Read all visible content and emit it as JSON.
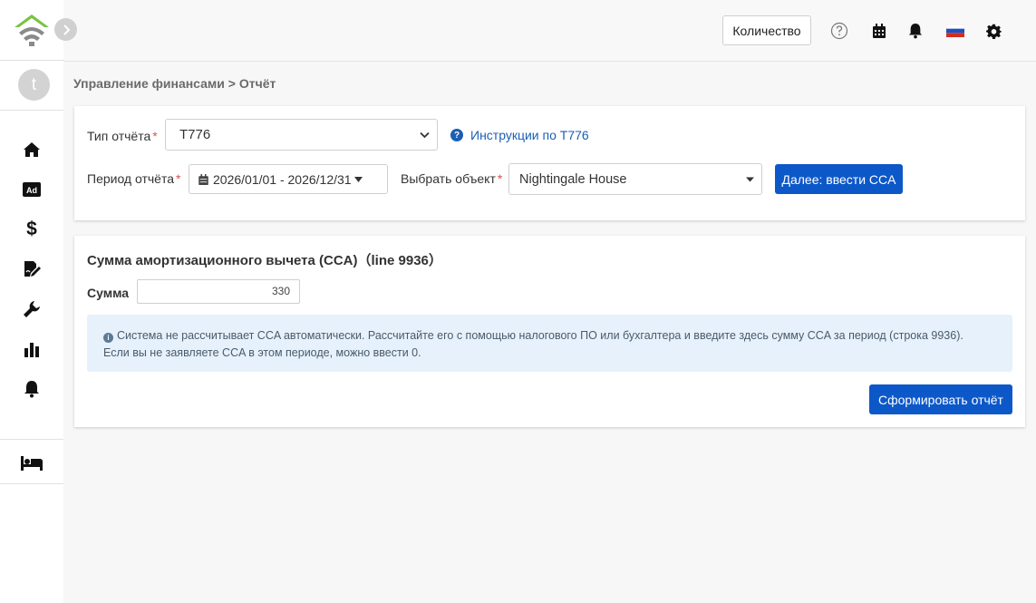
{
  "sidebar": {
    "avatar_initial": "t",
    "items": [
      {
        "name": "home-icon"
      },
      {
        "name": "ad-icon",
        "label": "Ad"
      },
      {
        "name": "dollar-icon",
        "label": "$"
      },
      {
        "name": "signature-icon"
      },
      {
        "name": "wrench-icon"
      },
      {
        "name": "bar-chart-icon"
      },
      {
        "name": "bell-icon"
      },
      {
        "name": "bed-icon"
      }
    ]
  },
  "topbar": {
    "quantity_button": "Количество",
    "icons": [
      "help-icon",
      "calendar-icon",
      "bell-icon",
      "russia-flag-icon",
      "gear-icon"
    ]
  },
  "breadcrumb": "Управление финансами > Отчёт",
  "report_form": {
    "type_label": "Тип отчёта",
    "type_value": "T776",
    "instructions_link": "Инструкции по T776",
    "period_label": "Период отчёта",
    "period_value": "2026/01/01 - 2026/12/31",
    "object_label": "Выбрать объект",
    "object_value": "Nightingale House",
    "next_button": "Далее: ввести CCA",
    "required_mark": "*"
  },
  "cca_section": {
    "title": "Сумма амортизационного вычета (CCA)（line 9936）",
    "amount_label": "Сумма",
    "amount_value": "330",
    "info_line1": "Система не рассчитывает CCA автоматически. Рассчитайте его с помощью налогового ПО или бухгалтера и введите здесь сумму CCA за период (строка 9936).",
    "info_line2": "Если вы не заявляете CCA в этом периоде, можно ввести 0.",
    "generate_button": "Сформировать отчёт"
  },
  "colors": {
    "primary": "#0d58c9",
    "link": "#1a5fb4",
    "required": "#d9534f",
    "info_bg": "#e6f1fb",
    "logo_green": "#7cc242",
    "logo_gray": "#8a8a8a"
  }
}
